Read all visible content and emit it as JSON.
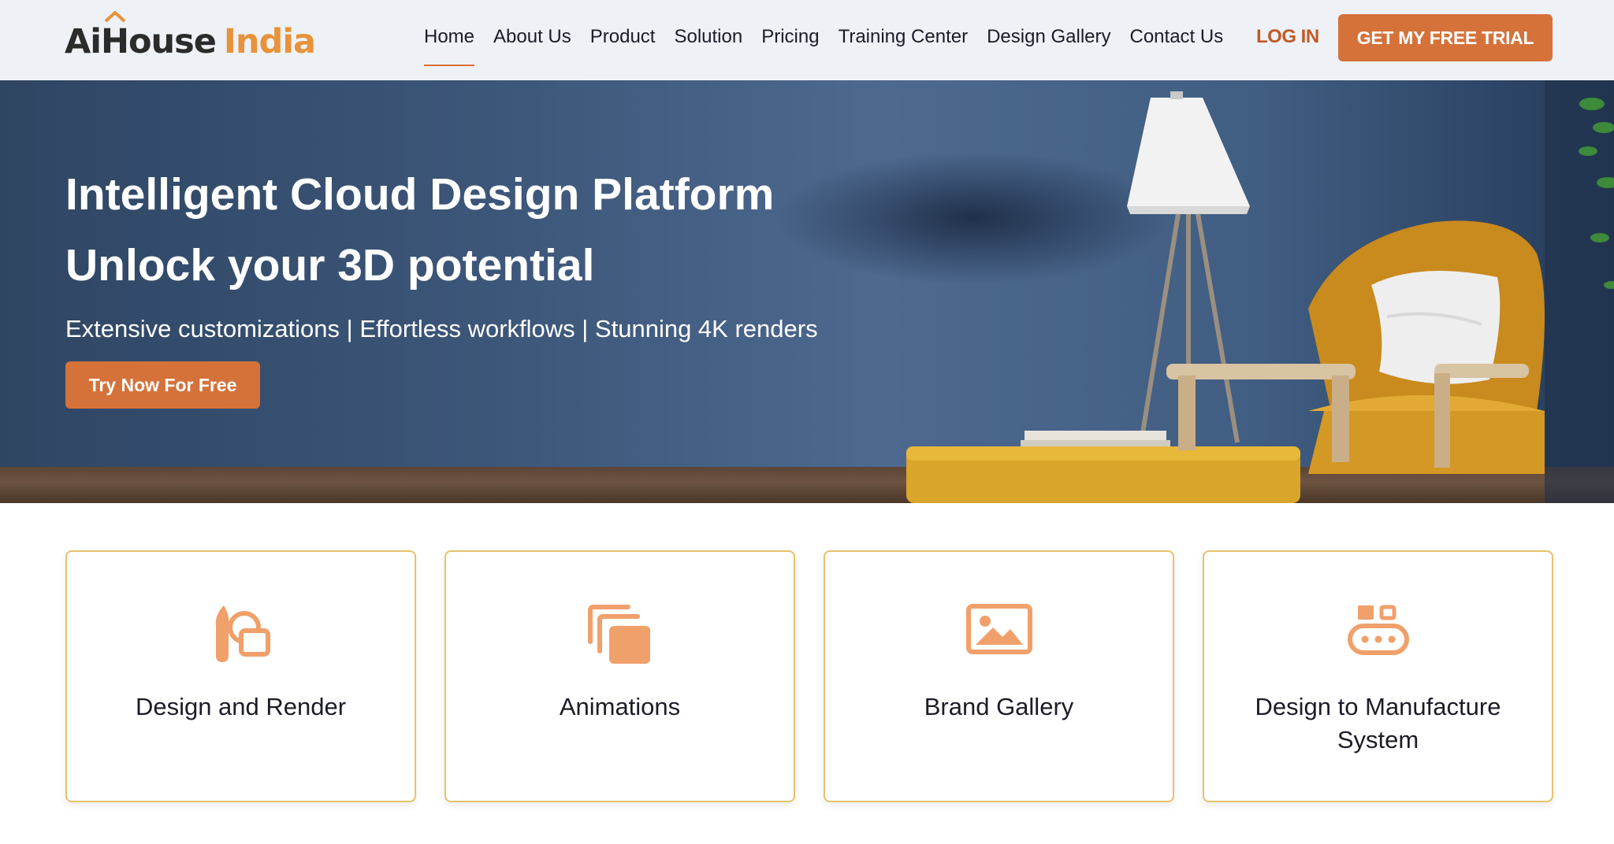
{
  "header": {
    "logo_ai": "AiHouse",
    "logo_india": "India",
    "nav": [
      {
        "label": "Home"
      },
      {
        "label": "About Us"
      },
      {
        "label": "Product"
      },
      {
        "label": "Solution"
      },
      {
        "label": "Pricing"
      },
      {
        "label": "Training Center"
      },
      {
        "label": "Design Gallery"
      },
      {
        "label": "Contact Us"
      }
    ],
    "active_nav": "Home",
    "login_label": "LOG IN",
    "trial_label": "GET MY FREE TRIAL"
  },
  "hero": {
    "title_line1": "Intelligent Cloud Design Platform",
    "title_line2": "Unlock your 3D potential",
    "subtitle": "Extensive customizations | Effortless workflows | Stunning 4K renders",
    "cta_label": "Try Now For Free"
  },
  "cards": [
    {
      "label": "Design and Render",
      "icon": "brush-icon"
    },
    {
      "label": "Animations",
      "icon": "layers-icon"
    },
    {
      "label": "Brand Gallery",
      "icon": "image-icon"
    },
    {
      "label": "Design to Manufacture System",
      "icon": "conveyor-icon"
    }
  ],
  "colors": {
    "accent": "#d5723a",
    "logo_orange": "#e8923a",
    "header_bg": "#eef1f6",
    "card_border": "#e6c26a",
    "icon": "#f0a06a"
  }
}
